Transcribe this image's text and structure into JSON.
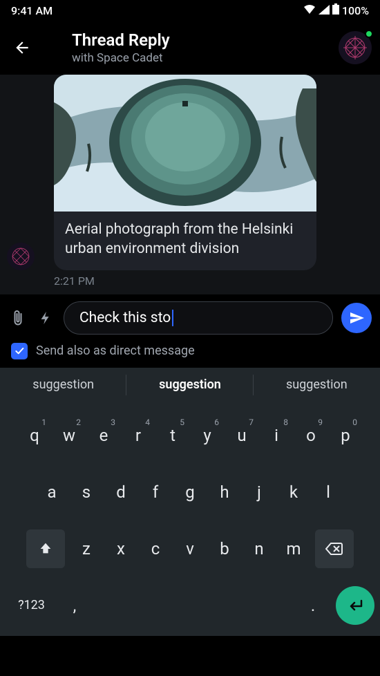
{
  "status": {
    "time": "9:41 AM",
    "battery": "100%"
  },
  "header": {
    "title": "Thread Reply",
    "subtitle": "with Space Cadet"
  },
  "message": {
    "caption": "Aerial photograph from the Helsinki urban environment division",
    "timestamp": "2:21 PM"
  },
  "compose": {
    "draft": "Check this sto",
    "dm_label": "Send also as direct message"
  },
  "suggestions": {
    "left": "suggestion",
    "mid": "suggestion",
    "right": "suggestion"
  },
  "keys": {
    "row1": [
      "q",
      "w",
      "e",
      "r",
      "t",
      "y",
      "u",
      "i",
      "o",
      "p"
    ],
    "hints": [
      "1",
      "2",
      "3",
      "4",
      "5",
      "6",
      "7",
      "8",
      "9",
      "0"
    ],
    "row2": [
      "a",
      "s",
      "d",
      "f",
      "g",
      "h",
      "j",
      "k",
      "l"
    ],
    "row3": [
      "z",
      "x",
      "c",
      "v",
      "b",
      "n",
      "m"
    ],
    "sym": "?123",
    "comma": ",",
    "period": "."
  }
}
